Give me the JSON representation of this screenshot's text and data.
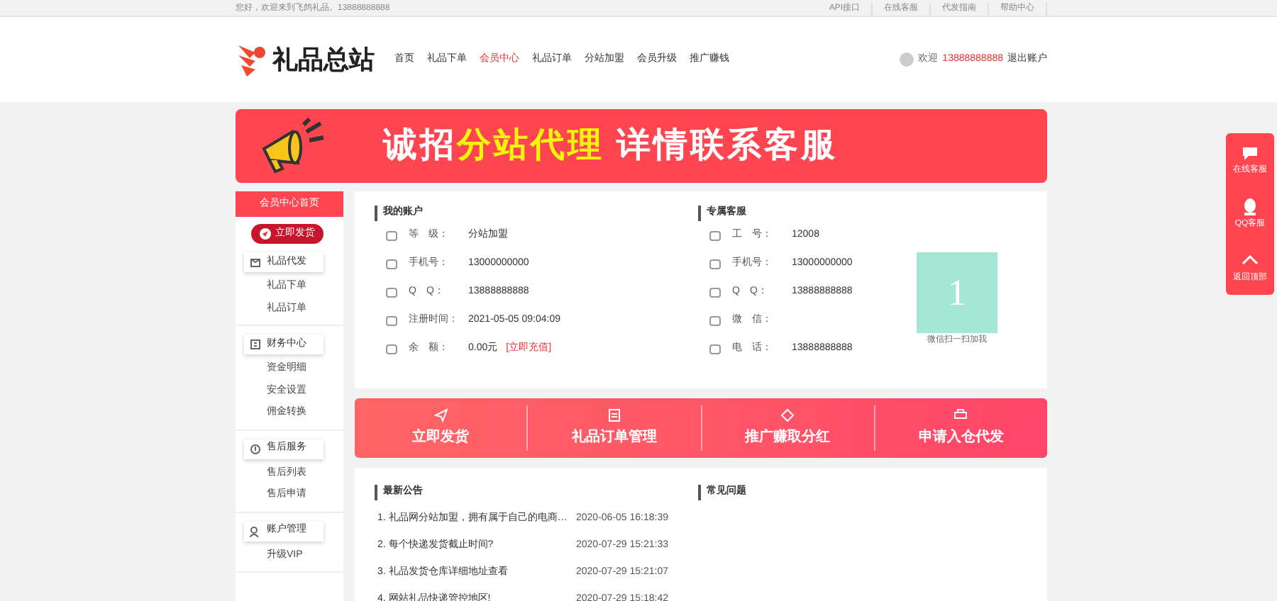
{
  "topbar": {
    "greeting": "您好，欢迎来到飞鸽礼品。",
    "phone": "13888888888",
    "links": [
      "API接口",
      "在线客服",
      "代发指南",
      "帮助中心"
    ]
  },
  "header": {
    "logo": "礼品总站",
    "nav": [
      {
        "label": "首页",
        "selected": false
      },
      {
        "label": "礼品下单",
        "selected": false
      },
      {
        "label": "会员中心",
        "selected": true
      },
      {
        "label": "礼品订单",
        "selected": false
      },
      {
        "label": "分站加盟",
        "selected": false
      },
      {
        "label": "会员升级",
        "selected": false
      },
      {
        "label": "推广赚钱",
        "selected": false
      }
    ],
    "user": {
      "greeting": "欢迎",
      "phone": "13888888888",
      "logout": "退出账户"
    }
  },
  "banner": {
    "parts": [
      {
        "text": "诚招",
        "highlight": false
      },
      {
        "text": "分站代理",
        "highlight": true
      },
      {
        "text": " 详情联系客服",
        "highlight": false
      }
    ]
  },
  "sidebar": {
    "title": "会员中心首页",
    "primary_button": "立即发货",
    "groups": [
      {
        "label": "礼品代发",
        "children": [
          {
            "label": "礼品下单"
          },
          {
            "label": "礼品订单"
          }
        ]
      },
      {
        "label": "财务中心",
        "children": [
          {
            "label": "资金明细"
          },
          {
            "label": "安全设置"
          },
          {
            "label": "佣金转换"
          }
        ]
      },
      {
        "label": "售后服务",
        "children": [
          {
            "label": "售后列表"
          },
          {
            "label": "售后申请"
          }
        ]
      },
      {
        "label": "账户管理",
        "children": [
          {
            "label": "升级VIP"
          }
        ]
      }
    ]
  },
  "account": {
    "title": "我的账户",
    "rows": [
      {
        "label": "等　级：",
        "value": "分站加盟"
      },
      {
        "label": "手机号：",
        "value": "13000000000"
      },
      {
        "label": "Q　Q：",
        "value": "13888888888"
      },
      {
        "label": "注册时间：",
        "value": "2021-05-05 09:04:09"
      },
      {
        "label": "余　额：",
        "value": "0.00元",
        "link": "[立即充值]"
      }
    ]
  },
  "service": {
    "title": "专属客服",
    "rows": [
      {
        "label": "工　号：",
        "value": "12008"
      },
      {
        "label": "手机号：",
        "value": "13000000000"
      },
      {
        "label": "Q　Q：",
        "value": "13888888888"
      },
      {
        "label": "微　信："
      },
      {
        "label": "电　话：",
        "value": "13888888888"
      }
    ],
    "qr_text": "1",
    "qr_caption": "微信扫一扫加我"
  },
  "actions": [
    {
      "label": "立即发货"
    },
    {
      "label": "礼品订单管理"
    },
    {
      "label": "推广赚取分红"
    },
    {
      "label": "申请入仓代发"
    }
  ],
  "notices": {
    "title": "最新公告",
    "items": [
      {
        "text": "1. 礼品网分站加盟，拥有属于自己的电商…",
        "time": "2020-06-05 16:18:39"
      },
      {
        "text": "2. 每个快递发货截止时间?",
        "time": "2020-07-29 15:21:33"
      },
      {
        "text": "3. 礼品发货仓库详细地址查看",
        "time": "2020-07-29 15:21:07"
      },
      {
        "text": "4. 网站礼品快递管控地区!",
        "time": "2020-07-29 15:18:42"
      }
    ]
  },
  "faq": {
    "title": "常见问题"
  },
  "float_bar": [
    {
      "label": "在线客服"
    },
    {
      "label": "QQ客服"
    },
    {
      "label": "返回顶部"
    }
  ]
}
